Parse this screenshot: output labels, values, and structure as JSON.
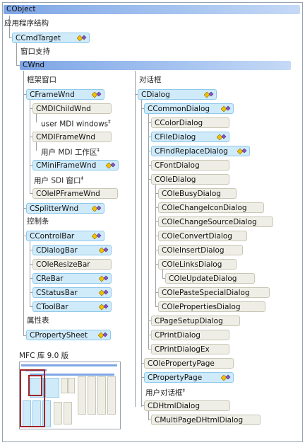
{
  "top": {
    "cobject": "CObject",
    "app_arch": "应用程序结构",
    "ccmdtarget": "CCmdTarget",
    "window_support": "窗口支持",
    "cwnd": "CWnd"
  },
  "left": {
    "frame_windows": "框架窗口",
    "cframewnd": "CFrameWnd",
    "cmdichildwnd": "CMDIChildWnd",
    "user_mdi_windows": "user MDI windows",
    "cmdiframewnd": "CMDIFrameWnd",
    "user_mdi_workspaces": "用户 MDI 工作区",
    "cminiframewnd": "CMiniFrameWnd",
    "user_sdi_windows": "用户 SDI 窗口",
    "coleipframewnd": "COleIPFrameWnd",
    "csplitterwnd": "CSplitterWnd",
    "control_bars": "控制条",
    "ccontrolbar": "CControlBar",
    "cdialogbar": "CDialogBar",
    "coleresizebar": "COleResizeBar",
    "crebar": "CReBar",
    "cstatusbar": "CStatusBar",
    "ctoolbar": "CToolBar",
    "property_sheets": "属性表",
    "cpropertysheet": "CPropertySheet",
    "mfc_title": "MFC 库 9.0 版",
    "dagger": "‡"
  },
  "right": {
    "dialog_boxes": "对话框",
    "cdialog": "CDialog",
    "ccommondialog": "CCommonDialog",
    "ccolordialog": "CColorDialog",
    "cfiledialog": "CFileDialog",
    "cfindreplacedialog": "CFindReplaceDialog",
    "cfontdialog": "CFontDialog",
    "coledialog": "COleDialog",
    "colebusydialog": "COleBusyDialog",
    "colechangeicondialog": "COleChangeIconDialog",
    "colechangesourcedialog": "COleChangeSourceDialog",
    "coleconvertdialog": "COleConvertDialog",
    "coleinsertdialog": "COleInsertDialog",
    "colelinksdialog": "COleLinksDialog",
    "coleupdatedialog": "COleUpdateDialog",
    "colepastespecialdialog": "COlePasteSpecialDialog",
    "colepropertiesdialog": "COlePropertiesDialog",
    "cpagesetupdialog": "CPageSetupDialog",
    "cprintdialog": "CPrintDialog",
    "cprintdialogex": "CPrintDialogEx",
    "colepropertypage": "COlePropertyPage",
    "cpropertypage": "CPropertyPage",
    "user_dialog_boxes": "用户对话框",
    "cdhtmldialog": "CDHtmlDialog",
    "cmultipagedhtmldialog": "CMultiPageDHtmlDialog"
  },
  "colors": {
    "header_bar": "#7ea6e6",
    "serializable_box": "#cfeaf9",
    "plain_box": "#efeee6",
    "connector": "#9aa0a6",
    "highlight": "#a0262a"
  },
  "legend_icons": [
    "serializable-icon",
    "runtime-class-icon"
  ]
}
